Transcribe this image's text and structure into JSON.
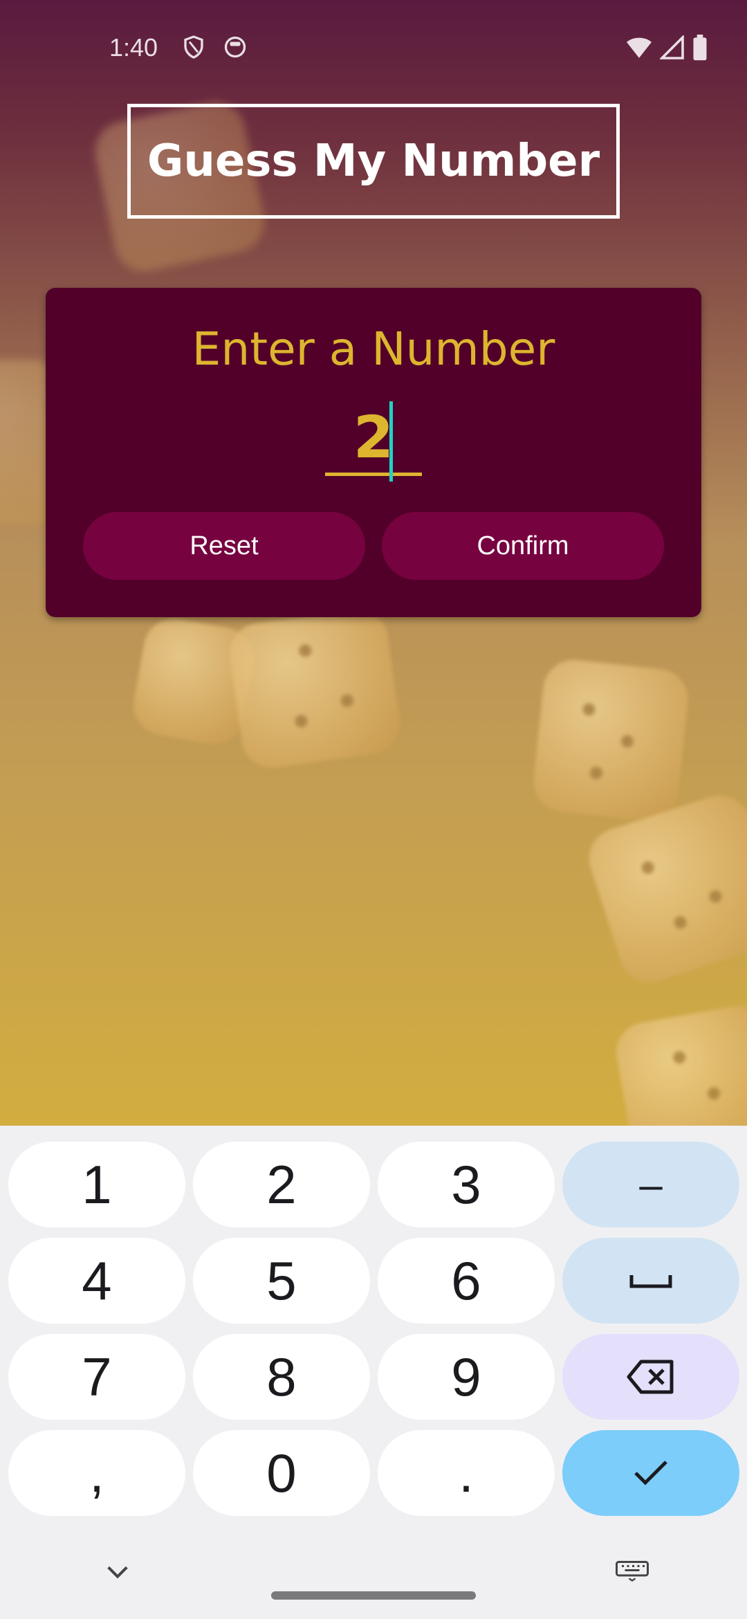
{
  "status_bar": {
    "time": "1:40",
    "left_icons": [
      "shield-icon",
      "robot-face-icon"
    ],
    "right_icons": [
      "wifi-icon",
      "cell-signal-icon",
      "battery-icon"
    ]
  },
  "app": {
    "title": "Guess My Number",
    "card": {
      "heading": "Enter a Number",
      "input_value": "2",
      "reset_label": "Reset",
      "confirm_label": "Confirm"
    },
    "colors": {
      "accent": "#ddb52f",
      "card": "#520029",
      "button": "#770240"
    }
  },
  "keyboard": {
    "rows": [
      [
        "1",
        "2",
        "3",
        "–"
      ],
      [
        "4",
        "5",
        "6",
        "␣"
      ],
      [
        "7",
        "8",
        "9",
        "⌫"
      ],
      [
        ",",
        "0",
        ".",
        "✓"
      ]
    ]
  }
}
